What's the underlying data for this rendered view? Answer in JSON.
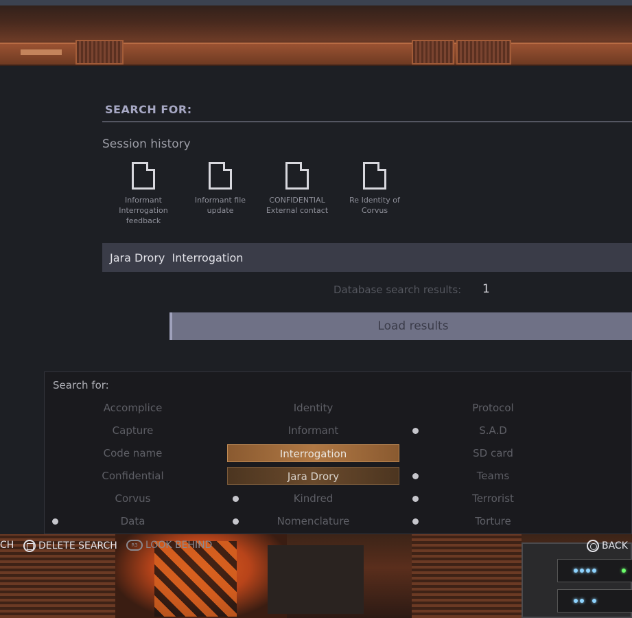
{
  "header": {
    "title": "SEARCH FOR:"
  },
  "session_history": {
    "label": "Session history",
    "items": [
      {
        "label": "Informant Interrogation feedback",
        "icon": "document-icon"
      },
      {
        "label": "Informant file update",
        "icon": "document-icon"
      },
      {
        "label": "CONFIDENTIAL External contact",
        "icon": "document-icon"
      },
      {
        "label": "Re Identity of Corvus",
        "icon": "document-icon"
      }
    ]
  },
  "query": {
    "text": "Jara Drory  Interrogation"
  },
  "results": {
    "label": "Database search results:",
    "count": "1"
  },
  "load_button": {
    "label": "Load results"
  },
  "keywords": {
    "title": "Search for:",
    "columns": [
      [
        "Accomplice",
        "Capture",
        "Code name",
        "Confidential",
        "Corvus",
        "Data"
      ],
      [
        "Identity",
        "Informant",
        "Interrogation",
        "Jara Drory",
        "Kindred",
        "Nomenclature"
      ],
      [
        "Protocol",
        "S.A.D",
        "SD card",
        "Teams",
        "Terrorist",
        "Torture"
      ]
    ],
    "selected": [
      "Interrogation",
      "Jara Drory"
    ]
  },
  "controls": {
    "search_fragment": "CH",
    "delete_search": "DELETE SEARCH",
    "look_behind": "LOOK BEHIND",
    "back": "BACK",
    "r3_glyph": "R3"
  },
  "colors": {
    "selected_keyword": "#b07844",
    "panel_background": "#1d1f24",
    "query_bar": "#3a3c48",
    "load_button": "#6f7186"
  }
}
